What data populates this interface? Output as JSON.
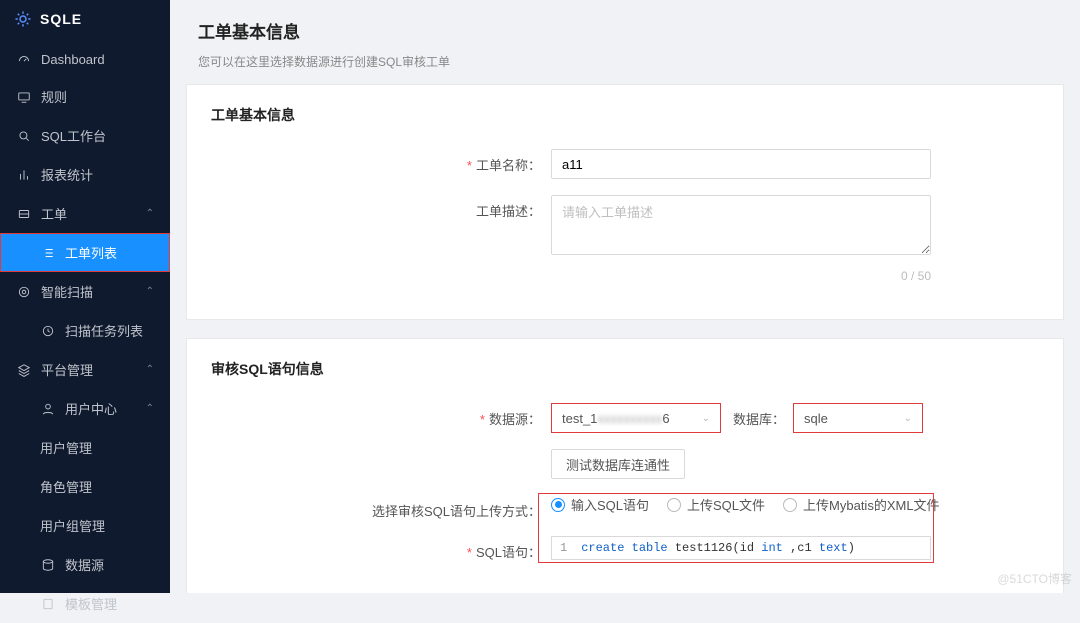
{
  "app": {
    "name": "SQLE",
    "watermark": "@51CTO博客"
  },
  "sidebar": {
    "items": [
      {
        "label": "Dashboard"
      },
      {
        "label": "规则"
      },
      {
        "label": "SQL工作台"
      },
      {
        "label": "报表统计"
      },
      {
        "label": "工单",
        "expand": true,
        "children": [
          {
            "label": "工单列表",
            "active": true
          }
        ]
      },
      {
        "label": "智能扫描",
        "expand": true,
        "children": [
          {
            "label": "扫描任务列表"
          }
        ]
      },
      {
        "label": "平台管理",
        "expand": true,
        "children": [
          {
            "label": "用户中心",
            "expand": true,
            "children": [
              {
                "label": "用户管理"
              },
              {
                "label": "角色管理"
              },
              {
                "label": "用户组管理"
              }
            ]
          },
          {
            "label": "数据源"
          },
          {
            "label": "模板管理"
          }
        ]
      }
    ]
  },
  "page": {
    "title": "工单基本信息",
    "subtitle": "您可以在这里选择数据源进行创建SQL审核工单"
  },
  "form1": {
    "title": "工单基本信息",
    "name_label": "工单名称：",
    "name_value": "a11",
    "desc_label": "工单描述：",
    "desc_placeholder": "请输入工单描述",
    "desc_counter": "0 / 50"
  },
  "form2": {
    "title": "审核SQL语句信息",
    "ds_label": "数据源：",
    "ds_value": "test_1          6",
    "db_label": "数据库：",
    "db_value": "sqle",
    "test_btn": "测试数据库连通性",
    "upload_label": "选择审核SQL语句上传方式：",
    "upload_options": [
      "输入SQL语句",
      "上传SQL文件",
      "上传Mybatis的XML文件"
    ],
    "upload_selected": 0,
    "sql_label": "SQL语句：",
    "sql_line_no": "1",
    "sql_tokens": [
      "create",
      "table",
      "test1126(id",
      "int",
      ",c1",
      "text",
      ")"
    ]
  }
}
